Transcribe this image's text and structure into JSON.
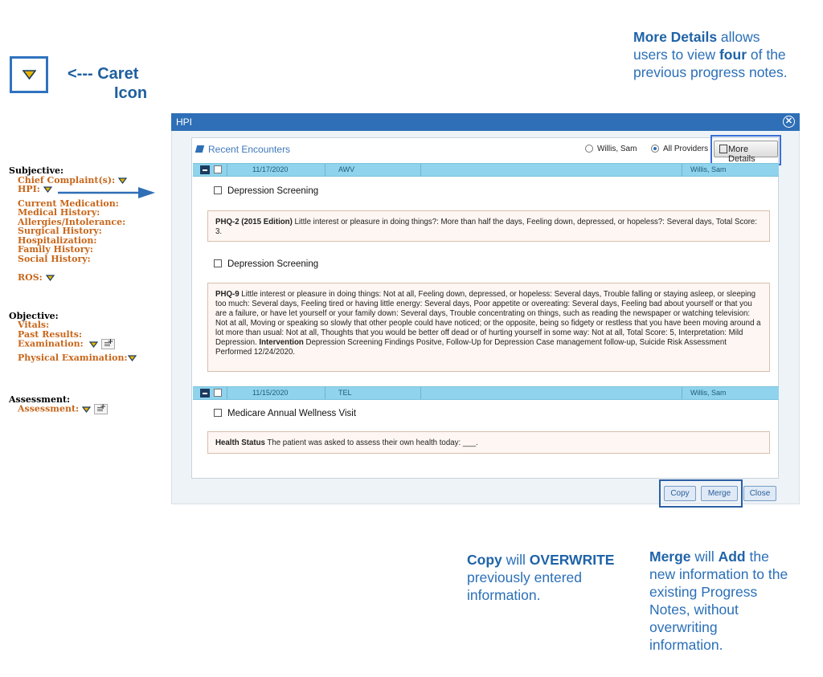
{
  "callouts": {
    "caret": {
      "line1": "<--- Caret",
      "line2": "Icon"
    },
    "more_details": {
      "strong1": "More Details",
      "text1": " allows users to view ",
      "strong2": "four",
      "text2": " of the previous progress notes."
    },
    "copy": {
      "strong1": "Copy",
      "text1": " will ",
      "strong2": "OVERWRITE",
      "text2": " previously entered information."
    },
    "merge": {
      "strong1": "Merge",
      "text1": " will ",
      "strong2": "Add",
      "text2": " the new information to the existing Progress Notes, without overwriting information."
    }
  },
  "sidebar": {
    "subjective": "Subjective:",
    "chief_complaint": "Chief Complaint(s):",
    "hpi": "HPI:",
    "current_medication": "Current Medication:",
    "medical_history": "Medical History:",
    "allergies": "Allergies/Intolerance:",
    "surgical_history": "Surgical History:",
    "hospitalization": "Hospitalization:",
    "family_history": "Family History:",
    "social_history": "Social History:",
    "ros": "ROS:",
    "objective": "Objective:",
    "vitals": "Vitals:",
    "past_results": "Past Results:",
    "examination": "Examination:",
    "physical_examination": "Physical Examination:",
    "assessment_header": "Assessment:",
    "assessment": "Assessment:"
  },
  "dialog": {
    "title": "HPI",
    "close_glyph": "✕",
    "recent_encounters": "Recent Encounters",
    "radio_willis": "Willis, Sam",
    "radio_all": "All Providers",
    "selected_radio": "All Providers",
    "more_details_button": "More Details",
    "encounters": [
      {
        "date": "11/17/2020",
        "type": "AWV",
        "provider": "Willis, Sam",
        "items": [
          {
            "title": "Depression Screening",
            "label": "PHQ-2 (2015 Edition)",
            "text": " Little interest or pleasure in doing things?: More than half the days, Feeling down, depressed, or hopeless?: Several days, Total Score: 3."
          },
          {
            "title": "Depression Screening",
            "label": "PHQ-9",
            "text": " Little interest or pleasure in doing things: Not at all, Feeling down, depressed, or hopeless: Several days, Trouble falling or staying asleep, or sleeping too much: Several days, Feeling tired or having little energy: Several days, Poor appetite or overeating: Several days, Feeling bad about yourself or that you are a failure, or have let yourself or your family down: Several days, Trouble concentrating on things, such as reading the newspaper or watching television: Not at all, Moving or speaking so slowly that other people could have noticed; or the opposite, being so fidgety or restless that you have been moving around a lot more than usual: Not at all, Thoughts that you would be better off dead or of hurting yourself in some way: Not at all, Total Score: 5, Interpretation: Mild Depression. ",
            "label2": "Intervention",
            "text2": " Depression Screening Findings Positve, Follow-Up for Depression Case management follow-up, Suicide Risk Assessment Performed 12/24/2020."
          }
        ]
      },
      {
        "date": "11/15/2020",
        "type": "TEL",
        "provider": "Willis, Sam",
        "items": [
          {
            "title": "Medicare Annual Wellness Visit",
            "label": "Health Status",
            "text": " The patient was asked to assess their own health today: ___."
          }
        ]
      }
    ],
    "buttons": {
      "copy": "Copy",
      "merge": "Merge",
      "close": "Close"
    }
  },
  "colors": {
    "caret_fill": "#e8b400",
    "caret_outline": "#1b3b5f",
    "title_bar": "#2e6fb7",
    "encounter_row": "#8fd3ec",
    "callout_text": "#2a6fb8",
    "sidebar_items": "#c8661a"
  },
  "icons": {
    "caret": "caret-down-icon",
    "arrow": "arrow-right-icon",
    "notes": "notes-add-icon",
    "more_details": "clipboard-icon"
  }
}
